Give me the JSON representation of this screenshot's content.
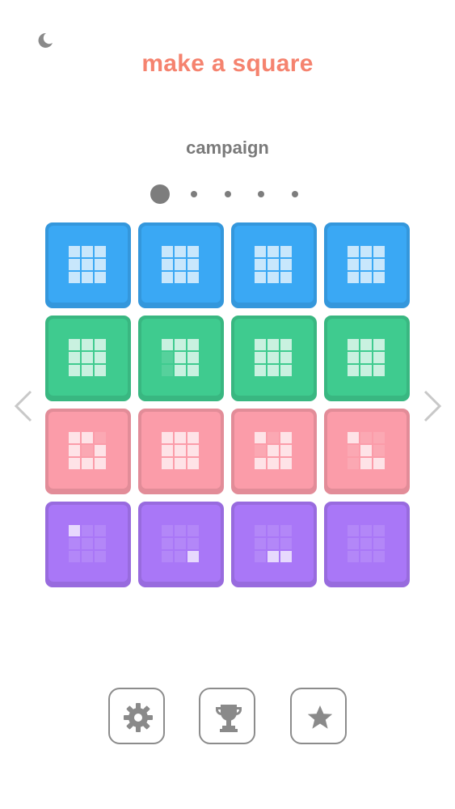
{
  "app": {
    "title": "make a square",
    "mode_label": "campaign"
  },
  "colors": {
    "title": "#f5836f",
    "blue": "#3aa8f4",
    "green": "#3fcb8f",
    "pink": "#fb9ca9",
    "purple": "#a977f7"
  },
  "icons": {
    "theme_toggle": "moon-icon",
    "prev": "chevron-left-icon",
    "next": "chevron-right-icon",
    "settings": "gear-icon",
    "achievements": "trophy-icon",
    "favorites": "star-icon"
  },
  "pager": {
    "pages": 5,
    "current": 1
  },
  "levels": [
    {
      "color": "#3aa8f4",
      "pattern": "111111111"
    },
    {
      "color": "#3aa8f4",
      "pattern": "111111111"
    },
    {
      "color": "#3aa8f4",
      "pattern": "111111111"
    },
    {
      "color": "#3aa8f4",
      "pattern": "111111111"
    },
    {
      "color": "#3fcb8f",
      "pattern": "111111111"
    },
    {
      "color": "#3fcb8f",
      "pattern": "111011011"
    },
    {
      "color": "#3fcb8f",
      "pattern": "111111111"
    },
    {
      "color": "#3fcb8f",
      "pattern": "111111111"
    },
    {
      "color": "#fb9ca9",
      "pattern": "110101111"
    },
    {
      "color": "#fb9ca9",
      "pattern": "111111111"
    },
    {
      "color": "#fb9ca9",
      "pattern": "101011111"
    },
    {
      "color": "#fb9ca9",
      "pattern": "100010011"
    },
    {
      "color": "#a977f7",
      "pattern": "100000000"
    },
    {
      "color": "#a977f7",
      "pattern": "000000001"
    },
    {
      "color": "#a977f7",
      "pattern": "000000011"
    },
    {
      "color": "#a977f7",
      "pattern": "000000000"
    }
  ]
}
